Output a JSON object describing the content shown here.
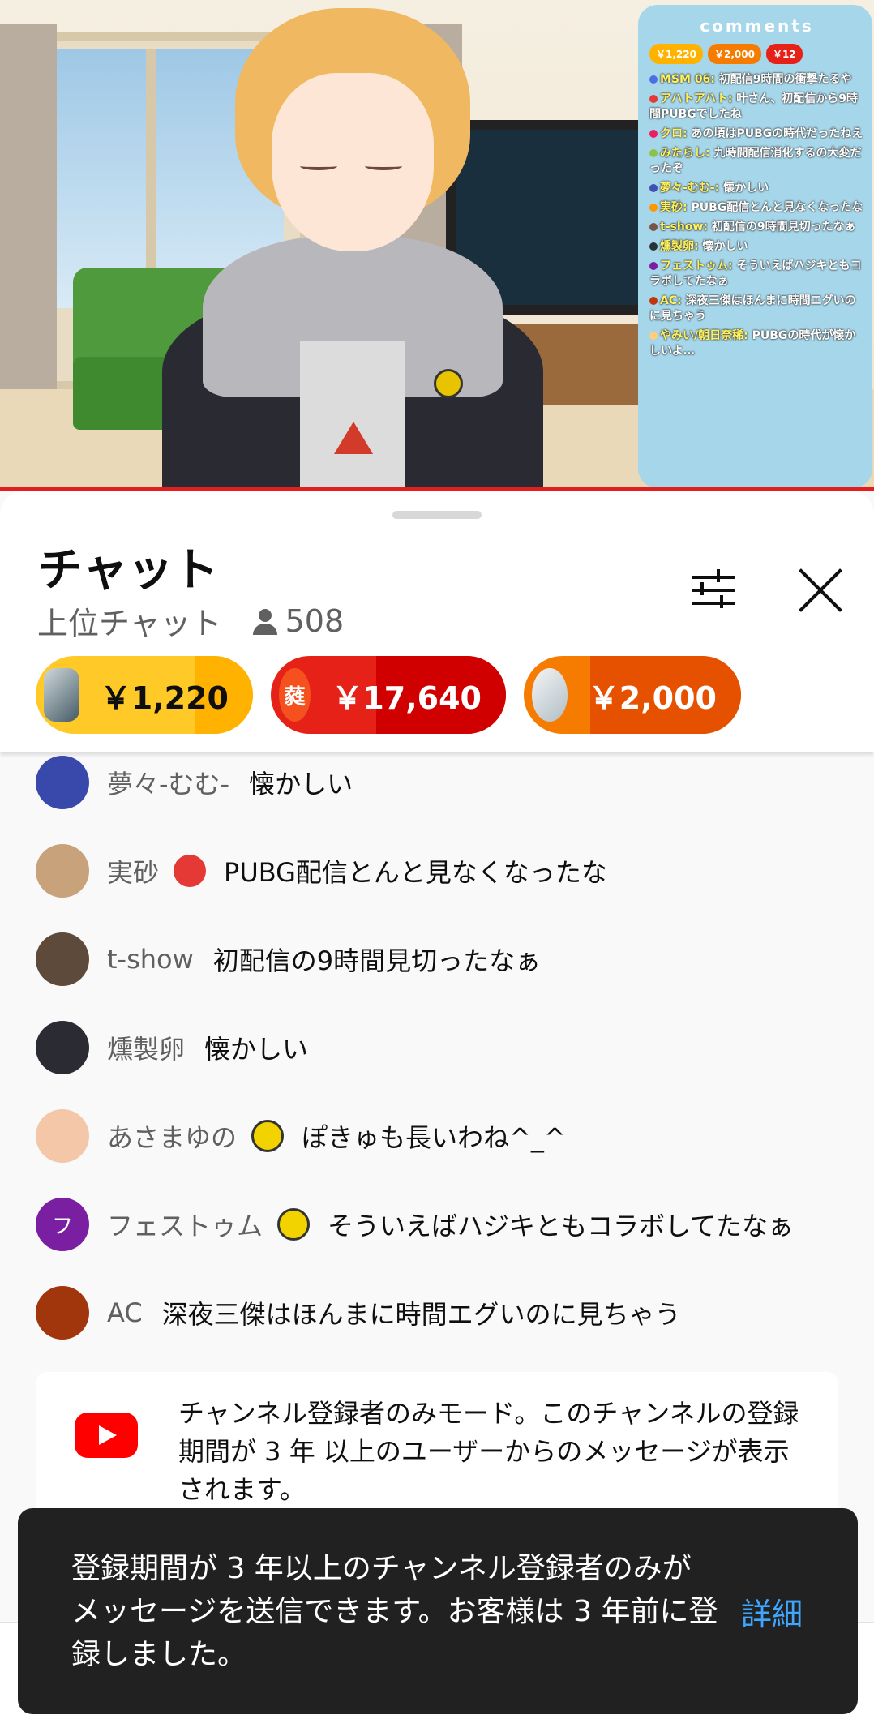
{
  "video": {
    "comments_panel": {
      "title": "comments",
      "chips": [
        {
          "amount": "￥1,220",
          "color": "#ffb300"
        },
        {
          "amount": "￥2,000",
          "color": "#f57c00"
        },
        {
          "amount": "￥12",
          "color": "#e62117"
        }
      ],
      "lines": [
        {
          "name": "MSM 06:",
          "text": "初配信9時間の衝撃たるや",
          "dot": "#4a6fe3"
        },
        {
          "name": "アハトアハト:",
          "text": "叶さん、初配信から9時間PUBGでしたね",
          "dot": "#e53935"
        },
        {
          "name": "クロ:",
          "text": "あの頃はPUBGの時代だったねえ",
          "dot": "#e91e63"
        },
        {
          "name": "みたらし:",
          "text": "九時間配信消化するの大変だったぞ",
          "dot": "#8bc34a"
        },
        {
          "name": "夢々-むむ-:",
          "text": "懐かしい",
          "dot": "#3f51b5"
        },
        {
          "name": "実砂:",
          "text": "PUBG配信とんと見なくなったな",
          "dot": "#ff9800"
        },
        {
          "name": "t-show:",
          "text": "初配信の9時間見切ったなぁ",
          "dot": "#795548"
        },
        {
          "name": "燻製卵:",
          "text": "懐かしい",
          "dot": "#263238"
        },
        {
          "name": "フェストゥム:",
          "text": "そういえばハジキともコラボしてたなぁ",
          "dot": "#7b1fa2"
        },
        {
          "name": "AC:",
          "text": "深夜三傑はほんまに時間エグいのに見ちゃう",
          "dot": "#bf360c"
        },
        {
          "name": "やみい/朝日奈稀:",
          "text": "PUBGの時代が懐かしいよ…",
          "dot": "#ffcc80"
        }
      ]
    }
  },
  "chat": {
    "title": "チャット",
    "mode": "上位チャット",
    "viewer_count": "508",
    "super_chats": [
      {
        "amount": "￥1,220",
        "avatar_text": ""
      },
      {
        "amount": "￥17,640",
        "avatar_text": "蕤"
      },
      {
        "amount": "￥2,000",
        "avatar_text": ""
      }
    ],
    "messages": [
      {
        "author": "夢々-むむ-",
        "text": "懐かしい",
        "avatar_color": "#3949ab",
        "avatar_text": ""
      },
      {
        "author": "実砂",
        "text": "PUBG配信とんと見なくなったな",
        "avatar_color": "#c8a27a",
        "avatar_text": "",
        "badge": "tomato"
      },
      {
        "author": "t-show",
        "text": "初配信の9時間見切ったなぁ",
        "avatar_color": "#5d4a3a",
        "avatar_text": ""
      },
      {
        "author": "燻製卵",
        "text": "懐かしい",
        "avatar_color": "#2b2b33",
        "avatar_text": ""
      },
      {
        "author": "あさまゆの",
        "text": "ぽきゅも長いわね^_^",
        "avatar_color": "#f4c7a8",
        "avatar_text": "",
        "badge": "member"
      },
      {
        "author": "フェストゥム",
        "text": "そういえばハジキともコラボしてたなぁ",
        "avatar_color": "#7b1fa2",
        "avatar_text": "フ",
        "badge": "member"
      },
      {
        "author": "AC",
        "text": "深夜三傑はほんまに時間エグいのに見ちゃう",
        "avatar_color": "#a1360c",
        "avatar_text": ""
      }
    ],
    "notice": {
      "text": "チャンネル登録者のみモード。このチャンネルの登録期間が 3 年 以上のユーザーからのメッセージが表示されます。"
    },
    "snackbar": {
      "text": "登録期間が 3 年以上のチャンネル登録者のみがメッセージを送信できます。お客様は 3 年前に登録しました。",
      "action": "詳細"
    }
  },
  "colors": {
    "progress": "#e21f1f",
    "link": "#3ea6ff",
    "snackbar_bg": "#212121"
  }
}
